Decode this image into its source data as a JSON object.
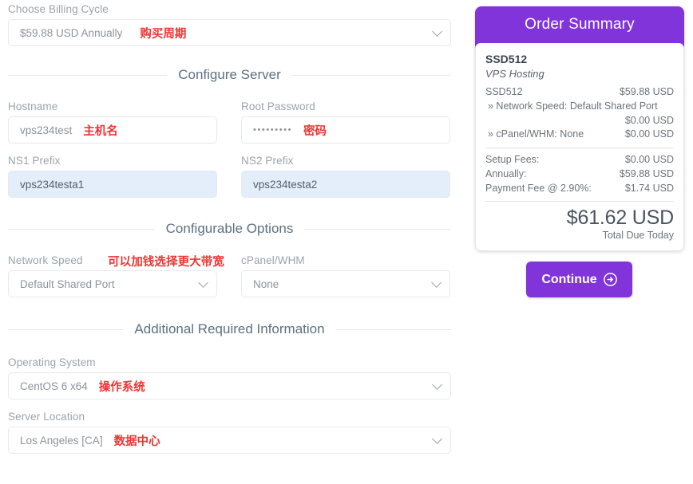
{
  "billing": {
    "label": "Choose Billing Cycle",
    "value": "$59.88 USD Annually",
    "annotation": "购买周期"
  },
  "sections": {
    "configure_server": "Configure Server",
    "configurable_options": "Configurable Options",
    "additional_required": "Additional Required Information"
  },
  "form": {
    "hostname": {
      "label": "Hostname",
      "value": "vps234test",
      "annotation": "主机名"
    },
    "root_password": {
      "label": "Root Password",
      "value": "•••••••••",
      "annotation": "密码"
    },
    "ns1_prefix": {
      "label": "NS1 Prefix",
      "value": "vps234testa1"
    },
    "ns2_prefix": {
      "label": "NS2 Prefix",
      "value": "vps234testa2"
    },
    "network_speed": {
      "label": "Network Speed",
      "value": "Default Shared Port",
      "annotation": "可以加钱选择更大带宽"
    },
    "cpanel_whm": {
      "label": "cPanel/WHM",
      "value": "None"
    },
    "operating_system": {
      "label": "Operating System",
      "value": "CentOS 6 x64",
      "annotation": "操作系统"
    },
    "server_location": {
      "label": "Server Location",
      "value": "Los Angeles [CA]",
      "annotation": "数据中心"
    }
  },
  "summary": {
    "title": "Order Summary",
    "product_name": "SSD512",
    "product_type": "VPS Hosting",
    "items": [
      {
        "label": "SSD512",
        "amount": "$59.88 USD",
        "wrap": false
      },
      {
        "label": "» Network Speed: Default Shared Port",
        "amount": "$0.00 USD",
        "wrap": true
      },
      {
        "label": "» cPanel/WHM: None",
        "amount": "$0.00 USD",
        "wrap": false
      }
    ],
    "fees": [
      {
        "label": "Setup Fees:",
        "amount": "$0.00 USD"
      },
      {
        "label": "Annually:",
        "amount": "$59.88 USD"
      },
      {
        "label": "Payment Fee @ 2.90%:",
        "amount": "$1.74 USD"
      }
    ],
    "total": "$61.62 USD",
    "total_caption": "Total Due Today"
  },
  "actions": {
    "continue_label": "Continue"
  },
  "colors": {
    "brand_purple": "#8134d9",
    "annotation_red": "#ee3333",
    "heading_slate": "#5c7184",
    "autofill_blue": "#e4eefb"
  }
}
